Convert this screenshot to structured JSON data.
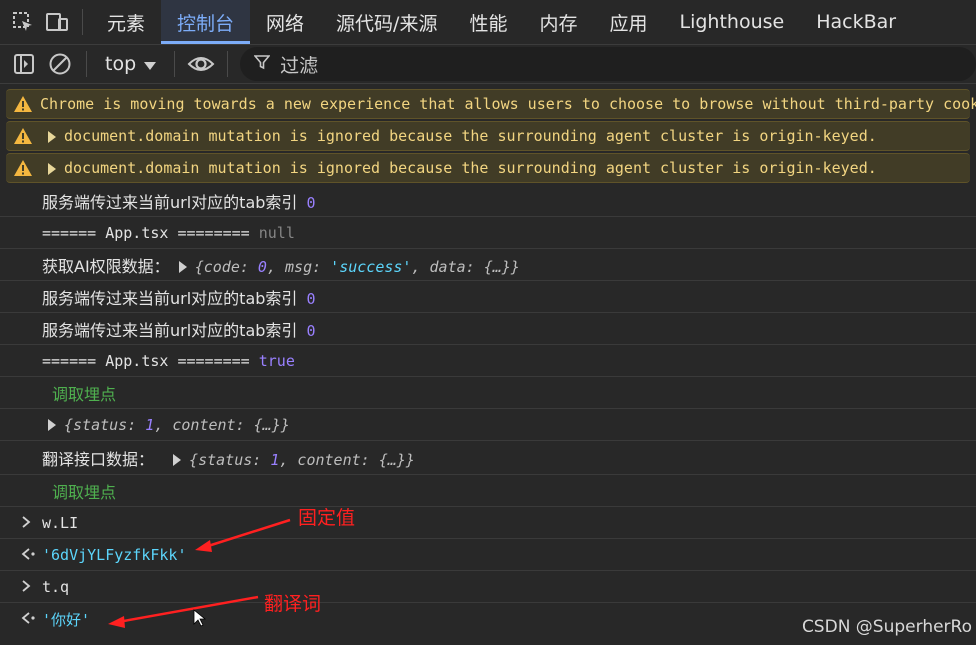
{
  "tabs": [
    "元素",
    "控制台",
    "网络",
    "源代码/来源",
    "性能",
    "内存",
    "应用",
    "Lighthouse",
    "HackBar"
  ],
  "active_tab": "控制台",
  "toolbar": {
    "context": "top",
    "filter_placeholder": "过滤"
  },
  "warnings": [
    "Chrome is moving towards a new experience that allows users to choose to browse without third-party cook",
    "document.domain mutation is ignored because the surrounding agent cluster is origin-keyed.",
    "document.domain mutation is ignored because the surrounding agent cluster is origin-keyed."
  ],
  "logs": {
    "l1_text": "服务端传过来当前url对应的tab索引",
    "l1_val": "0",
    "l2_text": "====== App.tsx ========",
    "l2_val": "null",
    "l3_text": "获取AI权限数据：",
    "l3_obj": {
      "open": "{",
      "k1": "code:",
      "v1": "0",
      "k2": "msg:",
      "v2": "'success'",
      "k3": "data:",
      "v3": "{…}",
      "close": "}"
    },
    "l4_text": "服务端传过来当前url对应的tab索引",
    "l4_val": "0",
    "l5_text": "服务端传过来当前url对应的tab索引",
    "l5_val": "0",
    "l6_text": "====== App.tsx ========",
    "l6_val": "true",
    "l7_text": "调取埋点",
    "l8_obj": {
      "open": "{",
      "k1": "status:",
      "v1": "1",
      "k2": "content:",
      "v2": "{…}",
      "close": "}"
    },
    "l9_text": "翻译接口数据：",
    "l9_obj": {
      "open": "{",
      "k1": "status:",
      "v1": "1",
      "k2": "content:",
      "v2": "{…}",
      "close": "}"
    },
    "l10_text": "调取埋点",
    "in1": "w.LI",
    "out1": "'6dVjYLFyzfkFkk'",
    "in2": "t.q",
    "out2": "'你好'"
  },
  "annotations": {
    "a1": "固定值",
    "a2": "翻译词"
  },
  "watermark": "CSDN @SuperherRo"
}
